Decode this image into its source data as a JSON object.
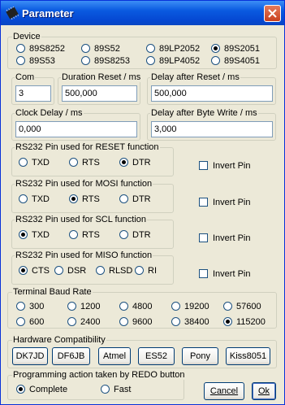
{
  "window": {
    "title": "Parameter",
    "title_icon": "chip-icon",
    "close_icon": "close-icon"
  },
  "device": {
    "label": "Device",
    "options": [
      "89S8252",
      "89S52",
      "89LP2052",
      "89S2051",
      "89S53",
      "89S8253",
      "89LP4052",
      "89S4051"
    ],
    "selected": "89S2051"
  },
  "com": {
    "label": "Com",
    "value": "3"
  },
  "duration_reset": {
    "label": "Duration Reset / ms",
    "value": "500,000"
  },
  "delay_after_reset": {
    "label": "Delay after Reset / ms",
    "value": "500,000"
  },
  "clock_delay": {
    "label": "Clock Delay / ms",
    "value": "0,000"
  },
  "delay_after_byte": {
    "label": "Delay after Byte Write / ms",
    "value": "3,000"
  },
  "reset_pin": {
    "label": "RS232 Pin used for RESET function",
    "options": [
      "TXD",
      "RTS",
      "DTR"
    ],
    "selected": "DTR",
    "invert_label": "Invert Pin",
    "invert": false
  },
  "mosi_pin": {
    "label": "RS232 Pin used for MOSI function",
    "options": [
      "TXD",
      "RTS",
      "DTR"
    ],
    "selected": "RTS",
    "invert_label": "Invert Pin",
    "invert": false
  },
  "scl_pin": {
    "label": "RS232 Pin used for SCL function",
    "options": [
      "TXD",
      "RTS",
      "DTR"
    ],
    "selected": "TXD",
    "invert_label": "Invert Pin",
    "invert": false
  },
  "miso_pin": {
    "label": "RS232 Pin used for MISO function",
    "options": [
      "CTS",
      "DSR",
      "RLSD",
      "RI"
    ],
    "selected": "CTS",
    "invert_label": "Invert Pin",
    "invert": false
  },
  "baud": {
    "label": "Terminal Baud Rate",
    "options": [
      "300",
      "1200",
      "4800",
      "19200",
      "57600",
      "600",
      "2400",
      "9600",
      "38400",
      "115200"
    ],
    "selected": "115200"
  },
  "hardware": {
    "label": "Hardware Compatibility",
    "buttons": [
      "DK7JD",
      "DF6JB",
      "Atmel",
      "ES52",
      "Pony",
      "Kiss8051"
    ]
  },
  "redo": {
    "label": "Programming action taken by REDO button",
    "options": [
      "Complete",
      "Fast"
    ],
    "selected": "Complete"
  },
  "actions": {
    "cancel": "Cancel",
    "ok": "Ok"
  }
}
